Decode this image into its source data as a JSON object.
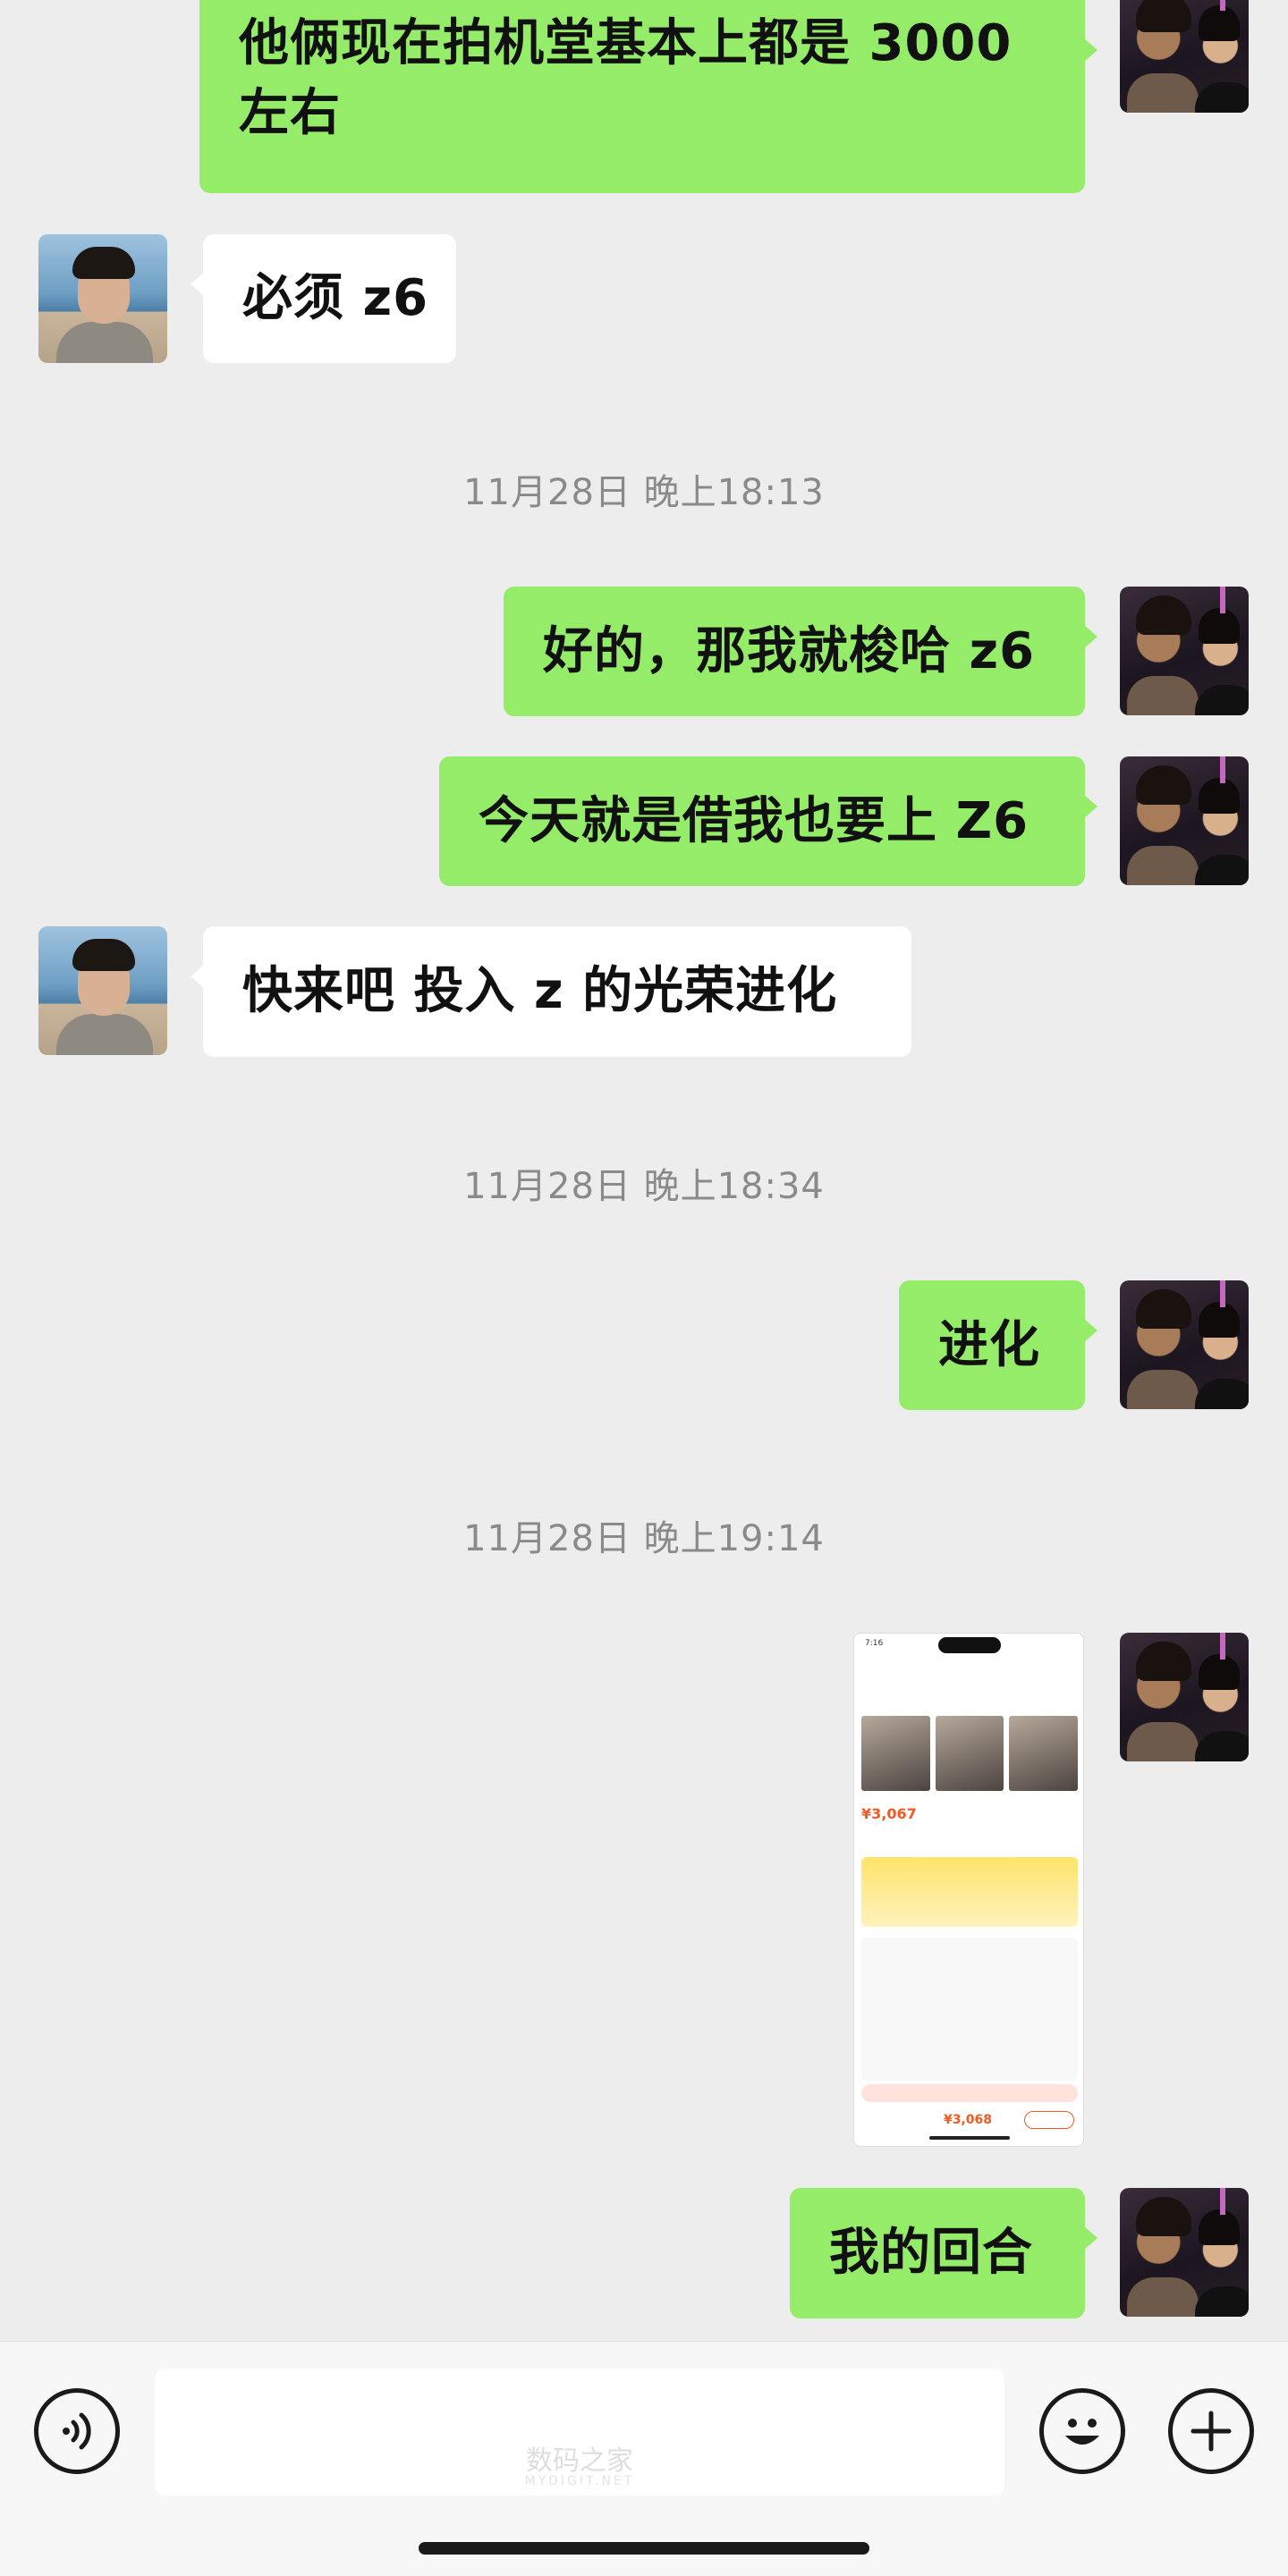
{
  "messages": [
    {
      "side": "me",
      "text": "他俩现在拍机堂基本上都是 3000 左右"
    },
    {
      "side": "them",
      "text": "必须 z6"
    },
    {
      "type": "time",
      "text": "11月28日 晚上18:13"
    },
    {
      "side": "me",
      "text": "好的，那我就梭哈 z6"
    },
    {
      "side": "me",
      "text": "今天就是借我也要上 Z6"
    },
    {
      "side": "them",
      "text": "快来吧 投入 z 的光荣进化"
    },
    {
      "type": "time",
      "text": "11月28日 晚上18:34"
    },
    {
      "side": "me",
      "text": "进化"
    },
    {
      "type": "time",
      "text": "11月28日 晚上19:14"
    },
    {
      "side": "me",
      "type": "image",
      "text": "screenshot"
    },
    {
      "side": "me",
      "text": "我的回合"
    }
  ],
  "bubbles": {
    "m1": "他俩现在拍机堂基本上都是 3000 左右",
    "m2": "必须 z6",
    "t1": "11月28日 晚上18:13",
    "m3": "好的，那我就梭哈 z6",
    "m4": "今天就是借我也要上 Z6",
    "m5": "快来吧 投入 z 的光荣进化",
    "t2": "11月28日 晚上18:34",
    "m6": "进化",
    "t3": "11月28日 晚上19:14",
    "m7": "我的回合"
  },
  "shared_image": {
    "status_time": "7:16",
    "price": "¥3,067",
    "total": "¥3,068"
  },
  "bottom_bar": {
    "voice_icon": "voice-icon",
    "emoji_icon": "emoji-icon",
    "plus_icon": "plus-icon",
    "watermark": "数码之家",
    "watermark_sub": "MYDIGIT.NET"
  },
  "colors": {
    "background": "#ededed",
    "my_bubble": "#95ec69",
    "their_bubble": "#ffffff",
    "timestamp": "#8a8a8a"
  }
}
